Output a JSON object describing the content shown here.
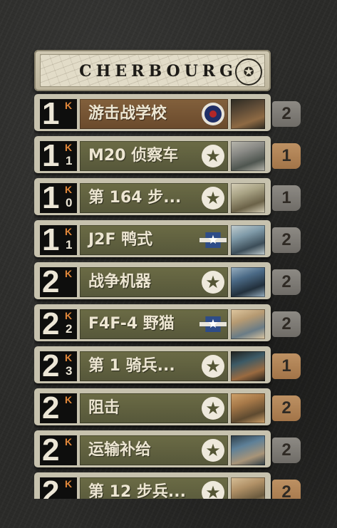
{
  "header": {
    "title": "CHERBOURG",
    "seal_icon": "us-eagle-seal-icon"
  },
  "cards": [
    {
      "cost": "1",
      "k": "K",
      "k_sub": "",
      "name": "游击战学校",
      "nation_icon": "uk-roundel-icon",
      "bar": "brown",
      "count": "2",
      "count_style": "gray",
      "art": [
        "#5c4a36",
        "#8e6a44",
        "#2c2a22"
      ]
    },
    {
      "cost": "1",
      "k": "K",
      "k_sub": "1",
      "name": "M20 侦察车",
      "nation_icon": "us-star-icon",
      "bar": "olive",
      "count": "1",
      "count_style": "tan",
      "art": [
        "#8a8a86",
        "#4f5650",
        "#b9b7ad"
      ]
    },
    {
      "cost": "1",
      "k": "K",
      "k_sub": "0",
      "name": "第 164 步...",
      "nation_icon": "us-star-icon",
      "bar": "olive",
      "count": "1",
      "count_style": "gray",
      "art": [
        "#a8a284",
        "#6b6248",
        "#d7d0b8"
      ]
    },
    {
      "cost": "1",
      "k": "K",
      "k_sub": "1",
      "name": "J2F 鸭式",
      "nation_icon": "us-navy-star-icon",
      "bar": "olive",
      "count": "2",
      "count_style": "gray",
      "art": [
        "#7f9aa8",
        "#3c4d58",
        "#c4d0d2"
      ]
    },
    {
      "cost": "2",
      "k": "K",
      "k_sub": "",
      "name": "战争机器",
      "nation_icon": "us-star-icon",
      "bar": "olive",
      "count": "2",
      "count_style": "gray",
      "art": [
        "#4b6a86",
        "#22303c",
        "#9ab1c2"
      ]
    },
    {
      "cost": "2",
      "k": "K",
      "k_sub": "2",
      "name": "F4F-4 野猫",
      "nation_icon": "us-navy-star-icon",
      "bar": "olive",
      "count": "2",
      "count_style": "gray",
      "art": [
        "#b69a72",
        "#6a7c86",
        "#e0c8a0"
      ]
    },
    {
      "cost": "2",
      "k": "K",
      "k_sub": "3",
      "name": "第 1 骑兵...",
      "nation_icon": "us-star-icon",
      "bar": "olive",
      "count": "1",
      "count_style": "tan",
      "art": [
        "#3c5a66",
        "#9a6a40",
        "#20201c"
      ]
    },
    {
      "cost": "2",
      "k": "K",
      "k_sub": "",
      "name": "阻击",
      "nation_icon": "us-star-icon",
      "bar": "olive",
      "count": "2",
      "count_style": "tan",
      "art": [
        "#a67848",
        "#5e4a30",
        "#d0a26a"
      ]
    },
    {
      "cost": "2",
      "k": "K",
      "k_sub": "",
      "name": "运输补给",
      "nation_icon": "us-star-icon",
      "bar": "olive",
      "count": "2",
      "count_style": "gray",
      "art": [
        "#5e8098",
        "#a89478",
        "#2d3c46"
      ]
    },
    {
      "cost": "2",
      "k": "K",
      "k_sub": "",
      "name": "第 12 步兵...",
      "nation_icon": "us-star-icon",
      "bar": "olive",
      "count": "2",
      "count_style": "tan",
      "art": [
        "#b09066",
        "#6a5a3e",
        "#d8c098"
      ]
    }
  ]
}
